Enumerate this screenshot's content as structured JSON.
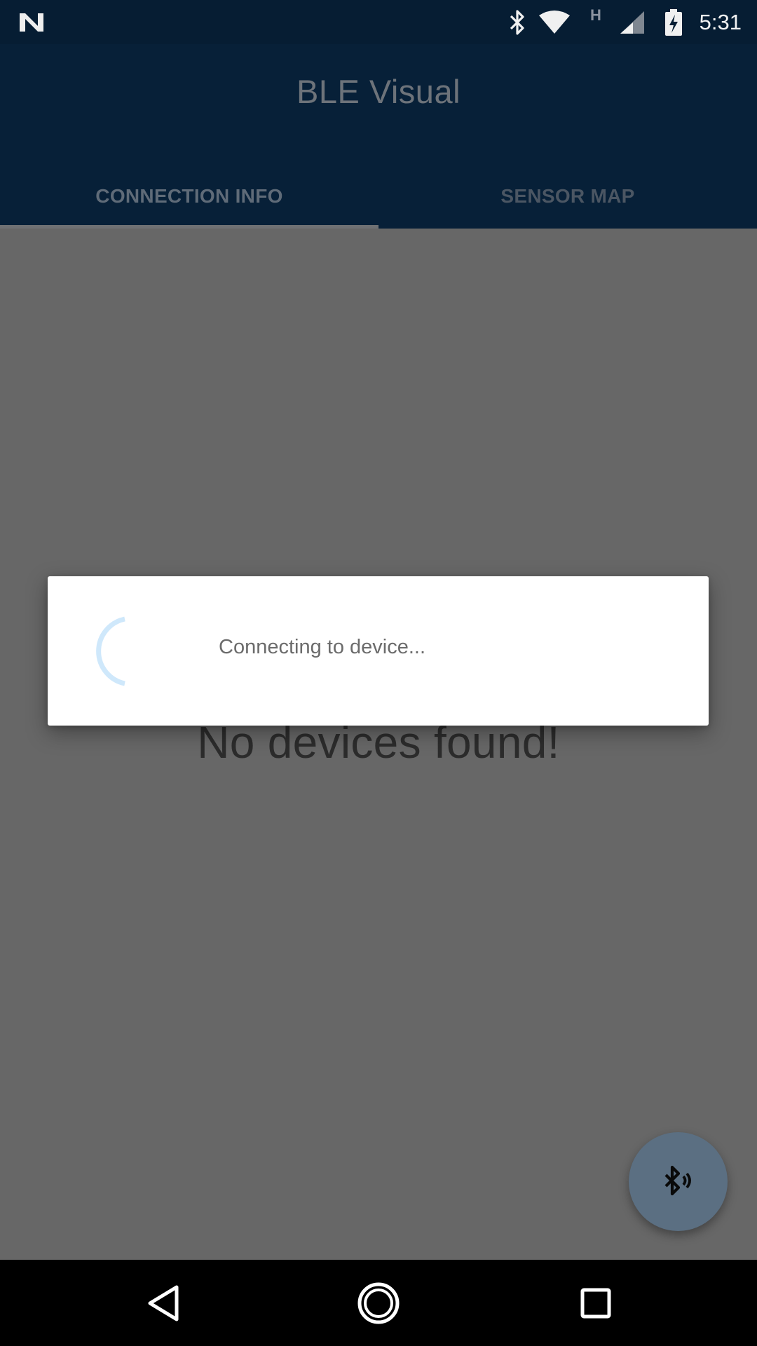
{
  "status_bar": {
    "time": "5:31",
    "network_type": "H",
    "icons": [
      "notification-n-icon",
      "bluetooth-icon",
      "wifi-icon",
      "cell-signal-icon",
      "battery-charging-icon"
    ]
  },
  "app_bar": {
    "title": "BLE Visual"
  },
  "tabs": [
    {
      "label": "CONNECTION INFO",
      "selected": true
    },
    {
      "label": "SENSOR MAP",
      "selected": false
    }
  ],
  "main": {
    "empty_message": "No devices found!"
  },
  "dialog": {
    "message": "Connecting to device..."
  },
  "fab": {
    "icon": "bluetooth-searching-icon"
  },
  "nav_bar": {
    "icons": [
      "back-icon",
      "home-icon",
      "recents-icon"
    ]
  },
  "colors": {
    "app_bar": "#072038",
    "status_bar": "#061d33",
    "scrim_background": "#676767",
    "dialog": "#ffffff",
    "spinner": "#cfe8fb",
    "fab": "#5b6f82"
  }
}
